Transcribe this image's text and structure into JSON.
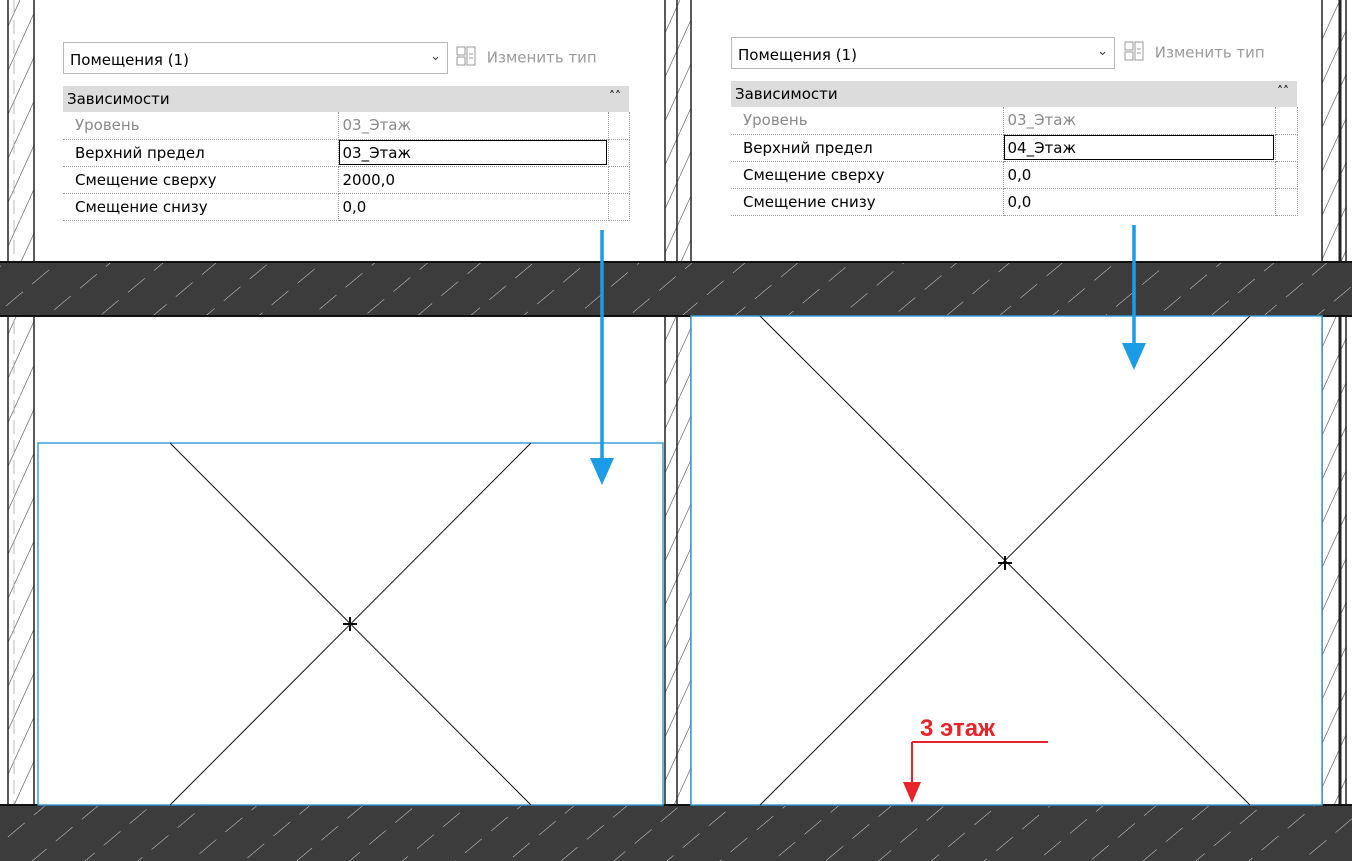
{
  "left_panel": {
    "type_selector": {
      "value": "Помещения (1)"
    },
    "edit_type_label": "Изменить тип",
    "category": {
      "label": "Зависимости"
    },
    "rows": [
      {
        "name": "Уровень",
        "value": "03_Этаж",
        "readonly": true
      },
      {
        "name": "Верхний предел",
        "value": "03_Этаж",
        "active": true
      },
      {
        "name": "Смещение сверху",
        "value": "2000,0"
      },
      {
        "name": "Смещение снизу",
        "value": "0,0"
      }
    ]
  },
  "right_panel": {
    "type_selector": {
      "value": "Помещения (1)"
    },
    "edit_type_label": "Изменить тип",
    "category": {
      "label": "Зависимости"
    },
    "rows": [
      {
        "name": "Уровень",
        "value": "03_Этаж",
        "readonly": true
      },
      {
        "name": "Верхний предел",
        "value": "04_Этаж",
        "active": true
      },
      {
        "name": "Смещение сверху",
        "value": "0,0"
      },
      {
        "name": "Смещение снизу",
        "value": "0,0"
      }
    ]
  },
  "annotation": {
    "label": "3 этаж"
  },
  "icons": {
    "chevron": "chevron-down-icon",
    "edit_type": "edit-type-icon",
    "collapse": "collapse-up-icon",
    "arrow": "arrow-down-icon"
  },
  "colors": {
    "slab": "#3c3c3c",
    "room_boundary": "#3aa0d8",
    "arrow": "#1c9be6",
    "annotation": "#e8232a",
    "category_bg": "#dcdcdc"
  }
}
